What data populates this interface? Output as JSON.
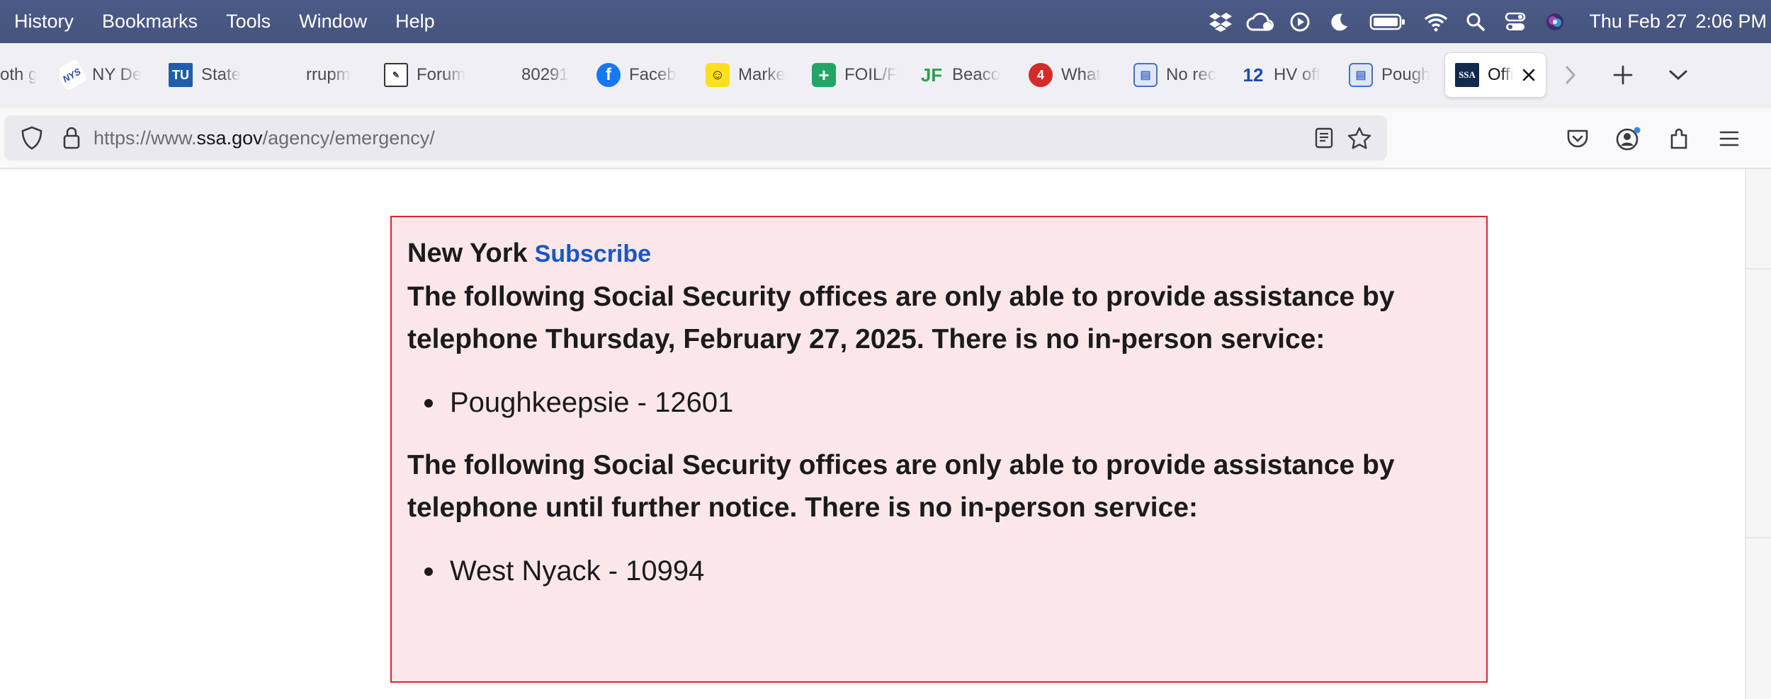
{
  "menubar": {
    "items": [
      "History",
      "Bookmarks",
      "Tools",
      "Window",
      "Help"
    ],
    "clock": {
      "date": "Thu Feb 27",
      "time": "2:06 PM"
    }
  },
  "tabs": [
    {
      "label": "oth g",
      "favicon": "none"
    },
    {
      "label": "NY De",
      "favicon": "nydec"
    },
    {
      "label": "State",
      "favicon": "TU"
    },
    {
      "label": "rrupm",
      "favicon": "none"
    },
    {
      "label": "Forum",
      "favicon": "forum"
    },
    {
      "label": "80291",
      "favicon": "none"
    },
    {
      "label": "Faceb",
      "favicon": "facebook"
    },
    {
      "label": "Marke",
      "favicon": "mailchimp"
    },
    {
      "label": "FOIL/F",
      "favicon": "sheets"
    },
    {
      "label": "Beaco",
      "favicon": "JF"
    },
    {
      "label": "What",
      "favicon": "4"
    },
    {
      "label": "No rec",
      "favicon": "doc"
    },
    {
      "label": "HV off",
      "favicon": "12"
    },
    {
      "label": "Pough",
      "favicon": "doc"
    },
    {
      "label": "Offi",
      "favicon": "SSA",
      "active": true
    }
  ],
  "url": {
    "scheme": "https://www.",
    "host": "ssa.gov",
    "path": "/agency/emergency/"
  },
  "alert": {
    "state": "New York",
    "subscribe": "Subscribe",
    "notice1": "The following Social Security offices are only able to provide assistance by telephone Thursday, February 27, 2025. There is no in-person service:",
    "offices1": [
      "Poughkeepsie - 12601"
    ],
    "notice2": "The following Social Security offices are only able to provide assistance by telephone until further notice. There is no in-person service:",
    "offices2": [
      "West Nyack - 10994"
    ]
  },
  "colors": {
    "alert_bg": "#fbe7ea",
    "alert_border": "#d9262c",
    "link": "#1a55c6",
    "menubar": "#4a5a86"
  }
}
